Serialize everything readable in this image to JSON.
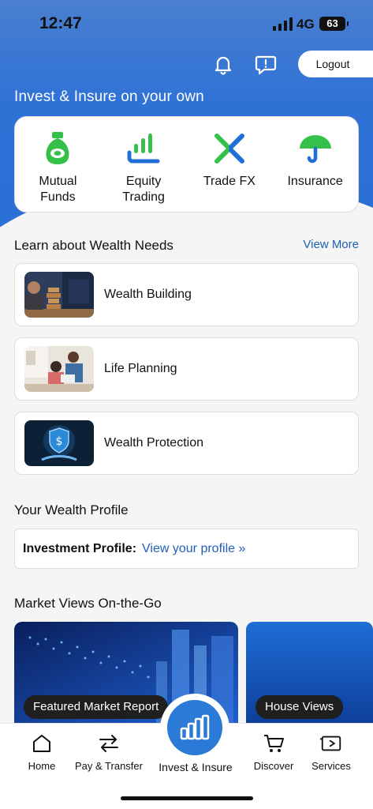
{
  "status_bar": {
    "time": "12:47",
    "network": "4G",
    "battery": "63"
  },
  "header": {
    "logout_label": "Logout",
    "title": "Invest & Insure on your own"
  },
  "products": [
    {
      "label": "Mutual\nFunds",
      "icon": "money-bag-icon"
    },
    {
      "label": "Equity\nTrading",
      "icon": "bar-chart-icon"
    },
    {
      "label": "Trade FX",
      "icon": "fx-icon"
    },
    {
      "label": "Insurance",
      "icon": "umbrella-icon"
    }
  ],
  "wealth_needs": {
    "title": "Learn about Wealth Needs",
    "view_more": "View More",
    "items": [
      {
        "label": "Wealth Building"
      },
      {
        "label": "Life Planning"
      },
      {
        "label": "Wealth Protection"
      }
    ]
  },
  "wealth_profile": {
    "title": "Your Wealth Profile",
    "key": "Investment Profile:",
    "link": "View your profile »"
  },
  "market_views": {
    "title": "Market Views On-the-Go",
    "cards": [
      {
        "label": "Featured Market Report"
      },
      {
        "label": "House Views"
      }
    ]
  },
  "tabbar": {
    "tabs": [
      {
        "label": "Home",
        "icon": "home-icon"
      },
      {
        "label": "Pay & Transfer",
        "icon": "transfer-icon"
      },
      {
        "label": "Invest & Insure",
        "icon": "invest-chart-icon"
      },
      {
        "label": "Discover",
        "icon": "cart-icon"
      },
      {
        "label": "Services",
        "icon": "services-icon"
      }
    ]
  },
  "colors": {
    "brand_blue": "#2c7ad8",
    "link_blue": "#1f5fb5",
    "green": "#35c04a"
  }
}
